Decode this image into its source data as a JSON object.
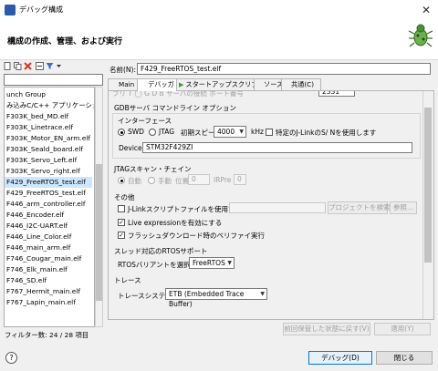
{
  "window": {
    "title": "デバッグ構成",
    "close_glyph": "✕"
  },
  "header": {
    "title": "構成の作成、管理、および実行"
  },
  "left_panel": {
    "filter_value": "",
    "items": [
      "unch Group",
      "み込みC/C++ アプリケーション",
      "F303K_bed_MD.elf",
      "F303K_Linetrace.elf",
      "F303K_Motor_EN_arm.elf",
      "F303K_Seald_board.elf",
      "F303K_Servo_Left.elf",
      "F303K_Servo_right.elf",
      "F429_FreeRTOS_test.elf",
      "F429_FreeRTOS_test.elf",
      "F446_arm_controller.elf",
      "F446_Encoder.elf",
      "F446_I2C-UART.elf",
      "F446_Line_Color.elf",
      "F446_main_arm.elf",
      "F746_Cougar_main.elf",
      "F746_Elk_main.elf",
      "F746_SD.elf",
      "F767_Hermit_main.elf",
      "F767_Lapin_main.elf"
    ],
    "selected_index": 8,
    "status": "フィルター数: 24 / 28 項目"
  },
  "config": {
    "name_label": "名前(N):",
    "name_value": "F429_FreeRTOS_test.elf",
    "tabs": [
      "Main",
      "デバッガ",
      "スタートアップスクリプト",
      "ソース",
      "共通(C)"
    ],
    "cut_row": "フリ T ◯ G D B サーバの接続  ポート番号",
    "cut_port": "2331",
    "gdb_title": "GDBサーバ コマンドライン オプション",
    "interface": {
      "title": "インターフェース",
      "swd": "SWD",
      "jtag": "JTAG",
      "speed_label": "初期スピード",
      "speed_value": "4000",
      "khz": "kHz",
      "serial_check": "特定のJ-LinkのS/ Nを使用します",
      "device_label": "Device",
      "device_value": "STM32F429ZI"
    },
    "jtag_chain": {
      "title": "JTAGスキャン・チェイン",
      "auto": "自動",
      "manual": "手動",
      "position_label": "位置",
      "position_value": "0",
      "irpre_label": "IRPre",
      "irpre_value": "0"
    },
    "other": {
      "title": "その他",
      "script_check": "J-Linkスクリプトファイルを使用する",
      "project_button": "プロジェクトを検索...",
      "browse_button": "参照...",
      "live_check": "Live expressionを有効にする",
      "verify_check": "フラッシュダウンロード時のベリファイ実行",
      "live_checked": true,
      "verify_checked": true
    },
    "rtos": {
      "title": "スレッド対応のRTOSサポート",
      "label": "RTOSバリアントを選択：",
      "value": "FreeRTOS"
    },
    "trace": {
      "title": "トレース",
      "label": "トレースシステム:",
      "value": "ETB (Embedded Trace Buffer)"
    },
    "revert_button": "前回保管した状態に戻す(V)",
    "apply_button": "適用(Y)"
  },
  "footer": {
    "help_glyph": "?",
    "debug_button": "デバッグ(D)",
    "close_button": "閉じる"
  },
  "colors": {
    "selection": "#cce8ff",
    "accent": "#0078d7",
    "icon_blue": "#2b5aa8"
  }
}
